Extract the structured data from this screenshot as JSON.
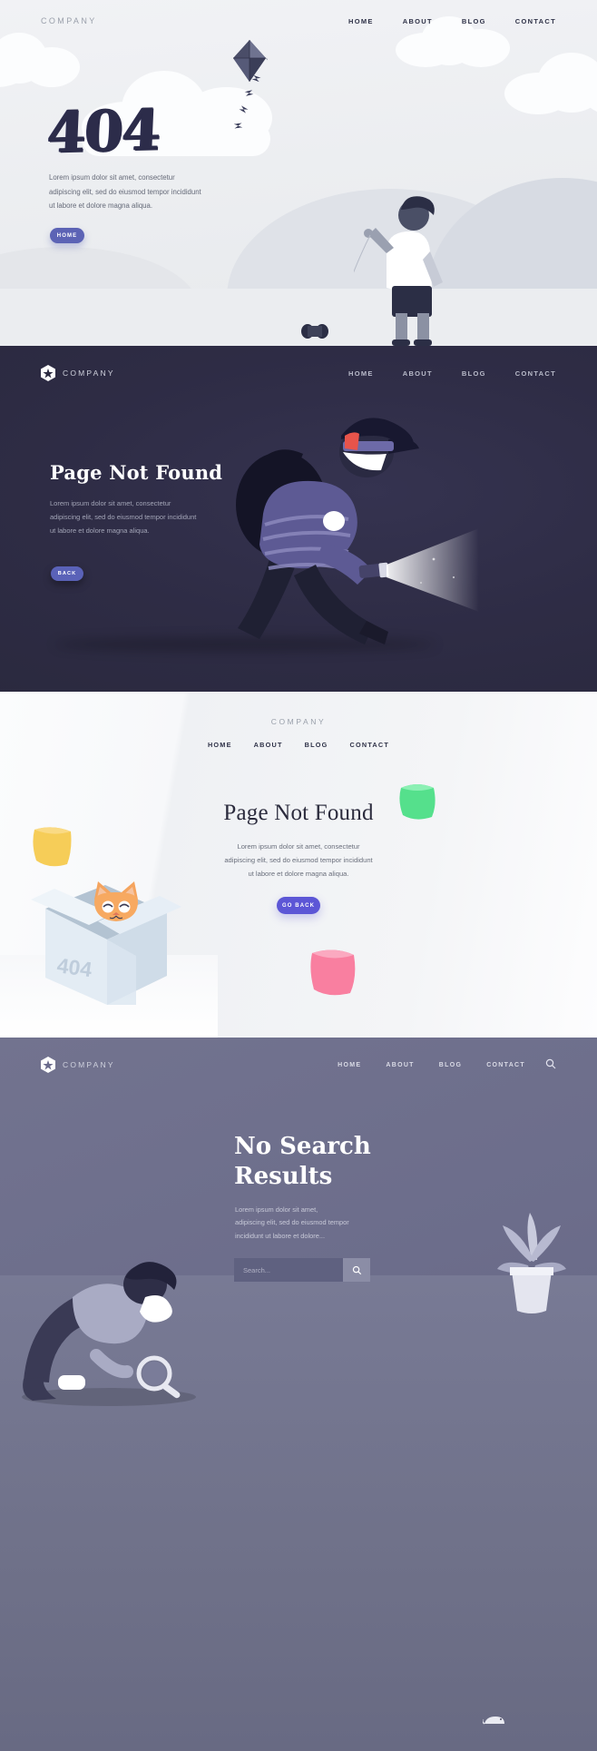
{
  "theme": {
    "accent_purple": "#5c63b5",
    "accent_violet": "#5c56d6",
    "dark_bg": "#2b2a40",
    "light_bg": "#eceef1",
    "purple_bg": "#6a6b8c",
    "ink": "#2c2c4a"
  },
  "panel1": {
    "name": "404 Kite Light",
    "brand": "COMPANY",
    "nav": [
      {
        "label": "HOME"
      },
      {
        "label": "ABOUT"
      },
      {
        "label": "BLOG"
      },
      {
        "label": "CONTACT"
      }
    ],
    "headline": "404",
    "body_lines": [
      "Lorem ipsum dolor sit amet, consectetur",
      "adipiscing elit, sed do eiusmod tempor incididunt",
      "ut labore et dolore magna aliqua."
    ],
    "button": "HOME",
    "illustration": "boy-flying-kite"
  },
  "panel2": {
    "name": "Page Not Found Dark Thief",
    "brand": "COMPANY",
    "logo_icon": "hexagon-star-icon",
    "nav": [
      {
        "label": "HOME"
      },
      {
        "label": "ABOUT"
      },
      {
        "label": "BLOG"
      },
      {
        "label": "CONTACT"
      }
    ],
    "headline": "Page Not Found",
    "body_lines": [
      "Lorem ipsum dolor sit amet, consectetur",
      "adipiscing elit, sed do eiusmod tempor incididunt",
      "ut labore et dolore magna aliqua."
    ],
    "button": "BACK",
    "illustration": "thief-with-flashlight-and-sack"
  },
  "panel3": {
    "name": "Page Not Found Cat In Box",
    "brand": "COMPANY",
    "nav": [
      {
        "label": "HOME"
      },
      {
        "label": "ABOUT"
      },
      {
        "label": "BLOG"
      },
      {
        "label": "CONTACT"
      }
    ],
    "headline": "Page Not Found",
    "body_lines": [
      "Lorem ipsum dolor sit amet, consectetur",
      "adipiscing elit, sed do eiusmod tempor incididunt",
      "ut labore et dolore magna aliqua."
    ],
    "button": "GO BACK",
    "box_number": "404",
    "illustration": "cat-peeking-out-of-cardboard-box",
    "sticky_notes": [
      {
        "name": "yellow",
        "color": "#f7cf5a"
      },
      {
        "name": "green",
        "color": "#5ce08a"
      },
      {
        "name": "pink",
        "color": "#f97fa0"
      }
    ]
  },
  "panel4": {
    "name": "No Search Results",
    "brand": "COMPANY",
    "logo_icon": "hexagon-star-icon",
    "nav": [
      {
        "label": "HOME"
      },
      {
        "label": "ABOUT"
      },
      {
        "label": "BLOG"
      },
      {
        "label": "CONTACT"
      }
    ],
    "search_icon": "search-icon",
    "headline_line1": "No Search",
    "headline_line2": "Results",
    "body_lines": [
      "Lorem ipsum dolor sit amet,",
      "adipiscing elit, sed do eiusmod tempor",
      "incididunt ut labore et dolore..."
    ],
    "search": {
      "value": "",
      "placeholder": "Search...",
      "button_icon": "search-icon"
    },
    "illustration": "man-searching-with-magnifier"
  }
}
